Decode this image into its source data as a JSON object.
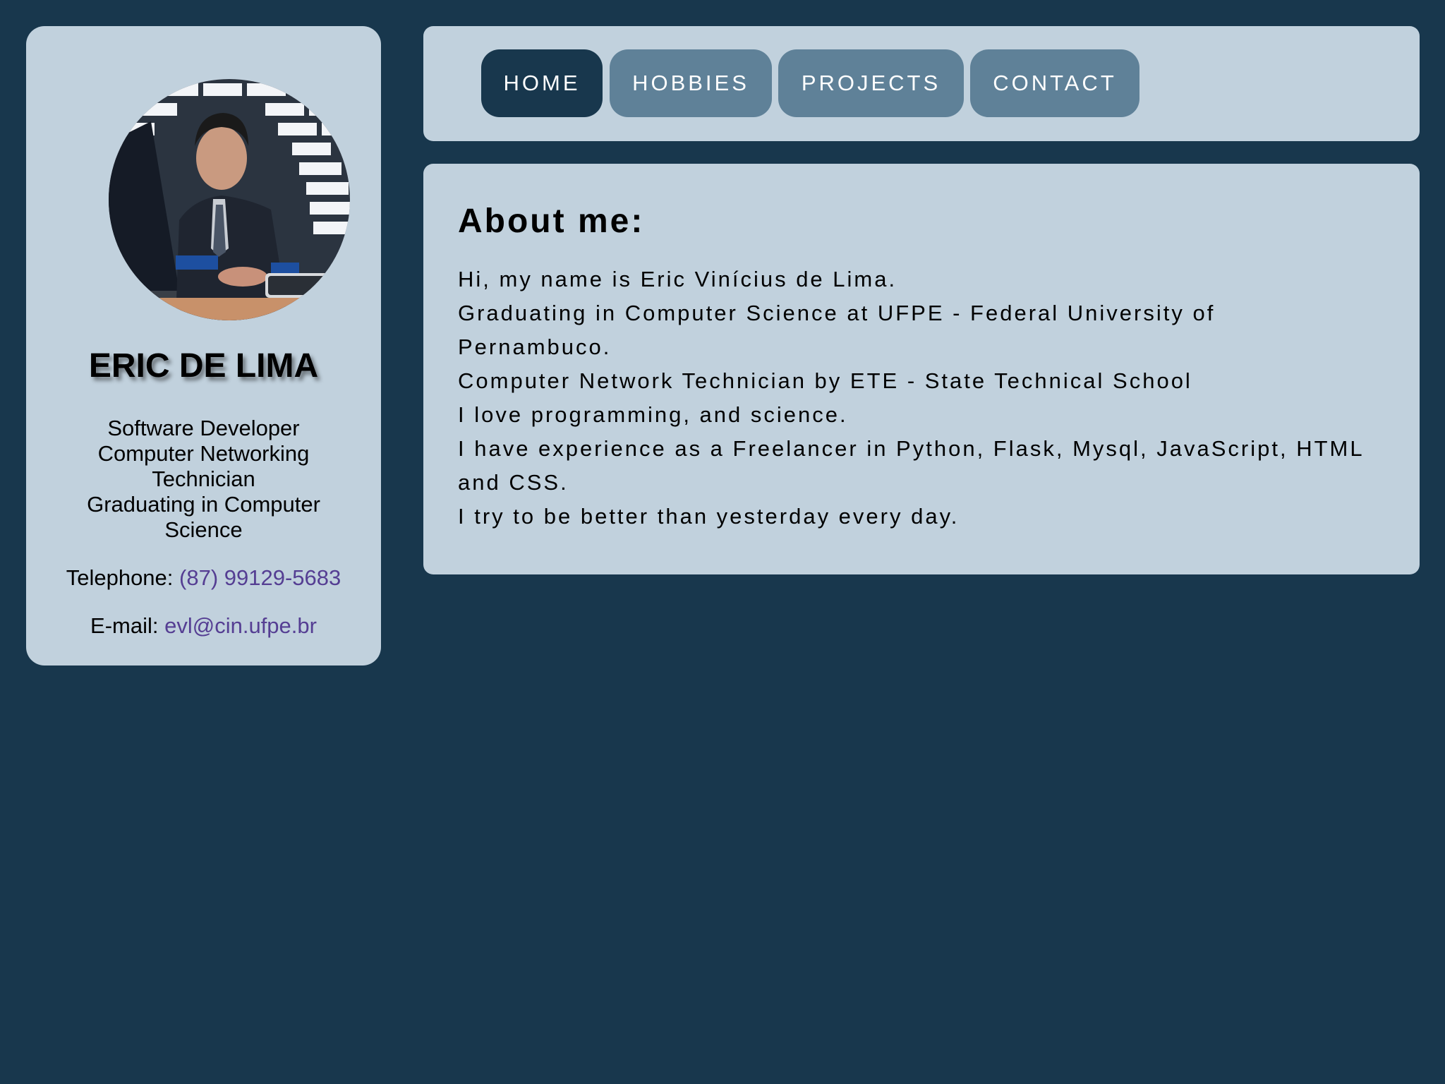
{
  "profile": {
    "name": "ERIC DE LIMA",
    "roles": [
      "Software Developer",
      "Computer Networking Technician",
      "Graduating in Computer Science"
    ],
    "telephone_label": "Telephone: ",
    "telephone_value": "(87) 99129-5683",
    "email_label": "E-mail: ",
    "email_value": "evl@cin.ufpe.br"
  },
  "nav": {
    "home": "HOME",
    "hobbies": "HOBBIES",
    "projects": "PROJECTS",
    "contact": "CONTACT",
    "active": "home"
  },
  "about": {
    "title": "About me:",
    "lines": [
      "Hi, my name is Eric Vinícius de Lima.",
      "Graduating in Computer Science at UFPE - Federal University of Pernambuco.",
      "Computer Network Technician by ETE - State Technical School",
      "I love programming, and science.",
      "I have experience as a Freelancer in Python, Flask, Mysql, JavaScript, HTML and CSS.",
      "I try to be better than yesterday every day."
    ]
  },
  "colors": {
    "page_bg": "#18374d",
    "card_bg": "#c1d1dd",
    "nav_button": "#5f8198",
    "nav_active": "#18374d",
    "link": "#553e93"
  }
}
